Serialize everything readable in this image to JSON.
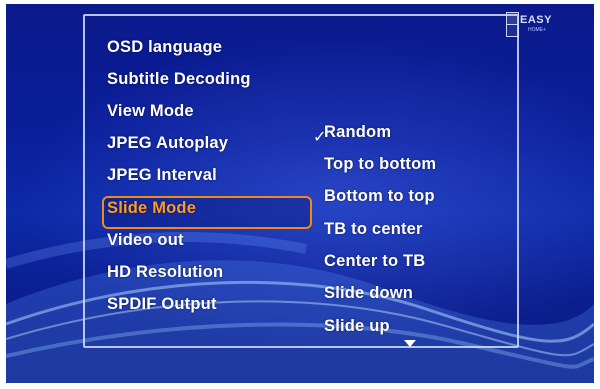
{
  "logo": {
    "word": "EASY",
    "sub": "HOME+"
  },
  "menu": {
    "items": [
      {
        "label": "OSD language"
      },
      {
        "label": "Subtitle Decoding"
      },
      {
        "label": "View Mode"
      },
      {
        "label": "JPEG Autoplay"
      },
      {
        "label": "JPEG Interval"
      },
      {
        "label": "Slide Mode"
      },
      {
        "label": "Video out"
      },
      {
        "label": "HD Resolution"
      },
      {
        "label": "SPDIF Output"
      }
    ],
    "selected_label": "Slide Mode"
  },
  "options": {
    "checked_glyph": "✓",
    "items": [
      {
        "label": "Random",
        "checked": true
      },
      {
        "label": "Top to bottom"
      },
      {
        "label": "Bottom to top"
      },
      {
        "label": "TB to center"
      },
      {
        "label": "Center to TB"
      },
      {
        "label": "Slide down"
      },
      {
        "label": "Slide up"
      }
    ]
  },
  "colors": {
    "accent": "#f08a14",
    "text": "#ffffff",
    "background": "#0a1f9a"
  }
}
